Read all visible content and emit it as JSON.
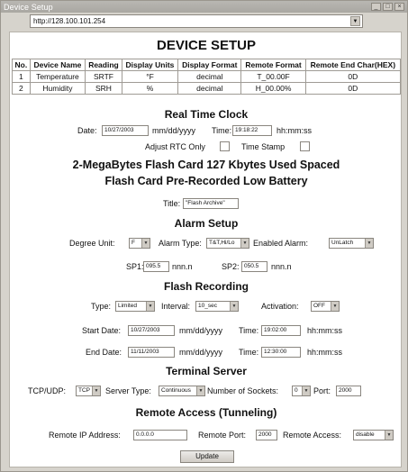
{
  "window": {
    "title": "Device Setup",
    "url": "http://128.100.101.254"
  },
  "page": {
    "heading": "DEVICE SETUP"
  },
  "devices": {
    "headers": [
      "No.",
      "Device Name",
      "Reading",
      "Display Units",
      "Display Format",
      "Remote Format",
      "Remote End Char(HEX)"
    ],
    "rows": [
      [
        "1",
        "Temperature",
        "SRTF",
        "°F",
        "decimal",
        "T_00.00F",
        "0D"
      ],
      [
        "2",
        "Humidity",
        "SRH",
        "%",
        "decimal",
        "H_00.00%",
        "0D"
      ]
    ]
  },
  "rtc": {
    "heading": "Real Time Clock",
    "date_label": "Date:",
    "date_value": "10/27/2003",
    "date_format": "mm/dd/yyyy",
    "time_label": "Time:",
    "time_value": "19:18:22",
    "time_format": "hh:mm:ss",
    "adjust_label": "Adjust RTC Only",
    "timestamp_label": "Time Stamp"
  },
  "flash": {
    "line1": "2-MegaBytes Flash Card   127 Kbytes Used Spaced",
    "line2": "Flash Card Pre-Recorded   Low Battery",
    "title_label": "Title:",
    "title_value": "\"Flash Archive\""
  },
  "alarm": {
    "heading": "Alarm Setup",
    "degree_label": "Degree Unit:",
    "degree_value": "F",
    "type_label": "Alarm Type:",
    "type_value": "T&T,Hi/Lo",
    "enabled_label": "Enabled Alarm:",
    "enabled_value": "UnLatch",
    "sp1_label": "SP1:",
    "sp1_value": "095.5",
    "sp1_unit": "nnn.n",
    "sp2_label": "SP2:",
    "sp2_value": "050.5",
    "sp2_unit": "nnn.n"
  },
  "recording": {
    "heading": "Flash Recording",
    "type_label": "Type:",
    "type_value": "Limited",
    "interval_label": "Interval:",
    "interval_value": "10_sec",
    "activation_label": "Activation:",
    "activation_value": "OFF",
    "start_date_label": "Start Date:",
    "start_date_value": "10/27/2003",
    "start_date_format": "mm/dd/yyyy",
    "start_time_label": "Time:",
    "start_time_value": "19:02:00",
    "start_time_format": "hh:mm:ss",
    "end_date_label": "End Date:",
    "end_date_value": "11/11/2003",
    "end_date_format": "mm/dd/yyyy",
    "end_time_label": "Time:",
    "end_time_value": "12:30:00",
    "end_time_format": "hh:mm:ss"
  },
  "terminal": {
    "heading": "Terminal Server",
    "tcp_label": "TCP/UDP:",
    "tcp_value": "TCP",
    "server_type_label": "Server Type:",
    "server_type_value": "Continuous",
    "sockets_label": "Number of Sockets:",
    "sockets_value": "0",
    "port_label": "Port:",
    "port_value": "2000"
  },
  "remote": {
    "heading": "Remote Access (Tunneling)",
    "ip_label": "Remote IP Address:",
    "ip_value": "0.0.0.0",
    "port_label": "Remote Port:",
    "port_value": "2000",
    "access_label": "Remote Access:",
    "access_value": "disable",
    "update_label": "Update"
  }
}
